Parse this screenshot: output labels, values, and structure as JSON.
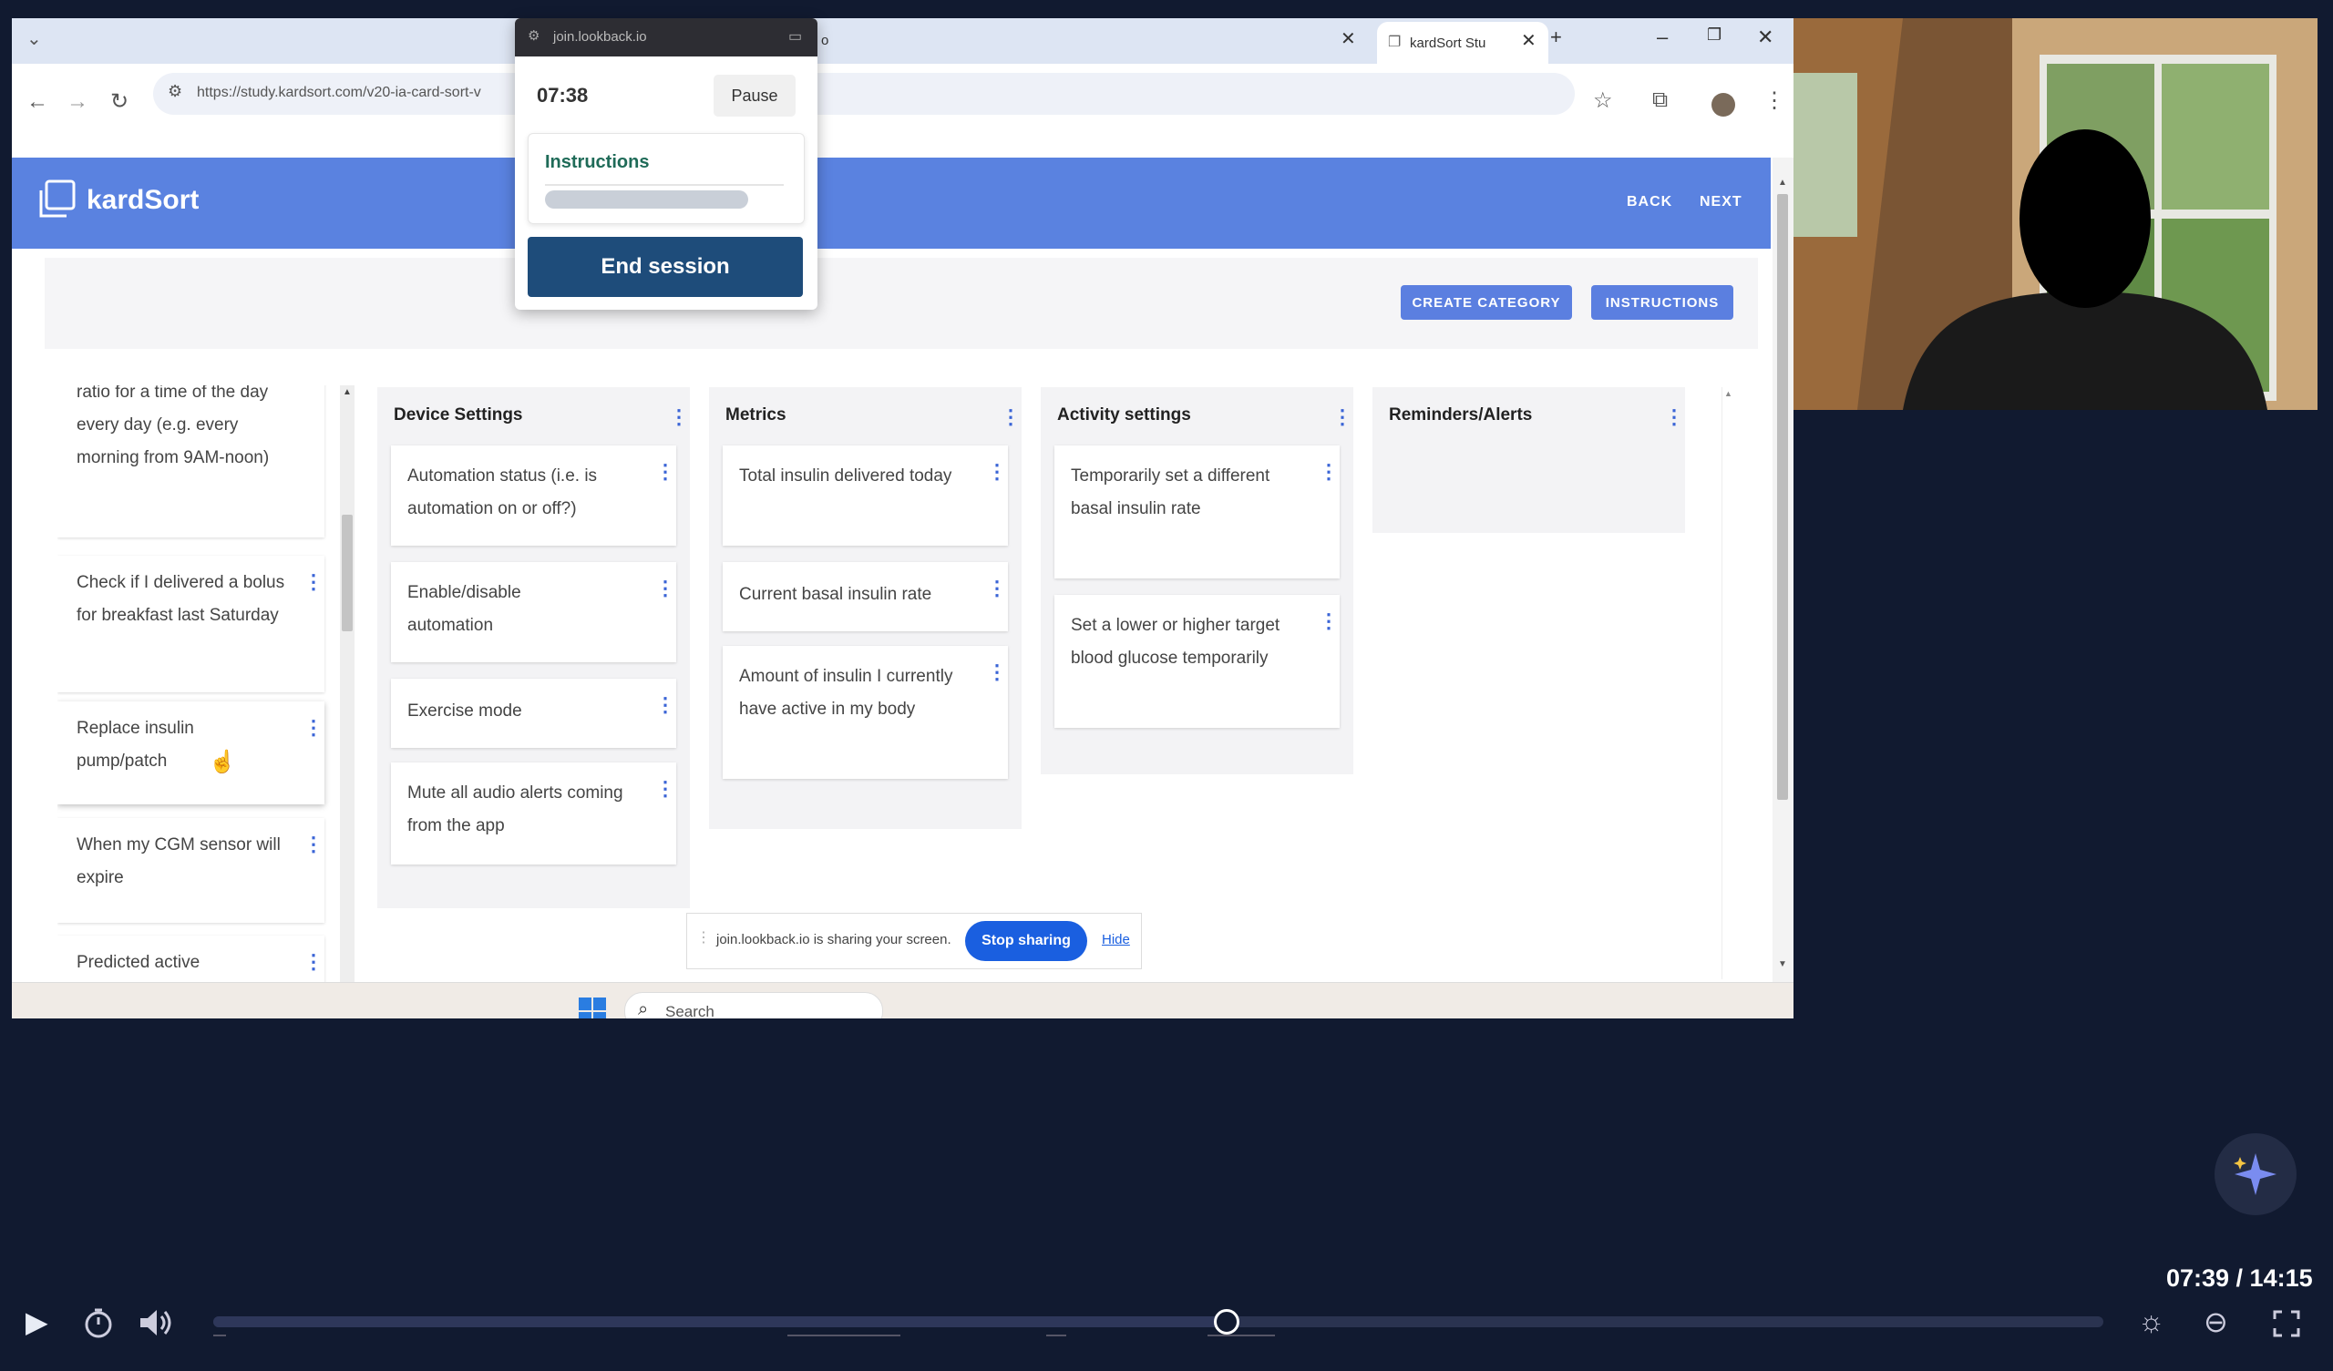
{
  "browser": {
    "tabs": [
      {
        "label": "o",
        "icon": "close-icon"
      },
      {
        "label": "kardSort Stu",
        "icon": "close-icon"
      }
    ],
    "new_tab": "+",
    "url": "https://study.kardsort.com/v20-ia-card-sort-v"
  },
  "app": {
    "logo": "kardSort",
    "nav": {
      "back": "BACK",
      "next": "NEXT"
    },
    "toolbar": {
      "create_category": "CREATE CATEGORY",
      "instructions": "INSTRUCTIONS"
    },
    "unsorted_cards": [
      "ratio for a time of the day every day (e.g. every morning from 9AM-noon)",
      "Check if I delivered a bolus for breakfast last Saturday",
      "Replace insulin pump/patch",
      "When my CGM sensor will expire",
      "Predicted active"
    ],
    "categories": [
      {
        "title": "Device Settings",
        "cards": [
          "Automation status (i.e. is automation on or off?)",
          "Enable/disable automation",
          "Exercise mode",
          "Mute all audio alerts coming from the app"
        ]
      },
      {
        "title": "Metrics",
        "cards": [
          "Total insulin delivered today",
          "Current basal insulin rate",
          "Amount of insulin I currently have active in my body"
        ]
      },
      {
        "title": "Activity settings",
        "cards": [
          "Temporarily set a different basal insulin rate",
          "Set a lower or higher target blood glucose temporarily"
        ]
      },
      {
        "title": "Reminders/Alerts",
        "cards": []
      }
    ]
  },
  "share_bar": {
    "message": "join.lookback.io is sharing your screen.",
    "stop": "Stop sharing",
    "hide": "Hide"
  },
  "taskbar": {
    "search_placeholder": "Search"
  },
  "lookback": {
    "domain": "join.lookback.io",
    "timer": "07:38",
    "pause": "Pause",
    "instructions": "Instructions",
    "instructions_progress": 0.85,
    "end_session": "End session"
  },
  "player": {
    "time": "07:39 / 14:15",
    "progress": 0.536
  },
  "colors": {
    "brand": "#5a82e0",
    "end_session": "#1e4c7a",
    "stop_sharing": "#1a5fe0",
    "player_bg": "#111a30"
  }
}
